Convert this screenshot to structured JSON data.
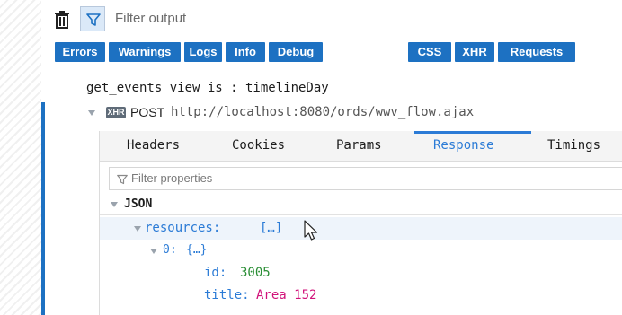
{
  "toolbar": {
    "trash_icon": "trash-icon",
    "filter_icon": "funnel-icon",
    "filter_placeholder": "Filter output"
  },
  "filters": {
    "errors": "Errors",
    "warnings": "Warnings",
    "logs": "Logs",
    "info": "Info",
    "debug": "Debug",
    "css": "CSS",
    "xhr": "XHR",
    "requests": "Requests"
  },
  "log": {
    "message": "get_events view is : timelineDay"
  },
  "request": {
    "badge": "XHR",
    "method": "POST",
    "url": "http://localhost:8080/ords/wwv_flow.ajax"
  },
  "tabs": {
    "headers": "Headers",
    "cookies": "Cookies",
    "params": "Params",
    "response": "Response",
    "timings": "Timings"
  },
  "response": {
    "filter_placeholder": "Filter properties",
    "section": "JSON",
    "resources_key": "resources:",
    "resources_preview": "[…]",
    "item_key": "0:",
    "item_preview": "{…}",
    "id_key": "id:",
    "id_value": "3005",
    "title_key": "title:",
    "title_value": "Area 152"
  },
  "colors": {
    "accent": "#1d71c2",
    "active_tab": "#2b7bd6",
    "number": "#2a8e35",
    "string": "#d1127a"
  }
}
